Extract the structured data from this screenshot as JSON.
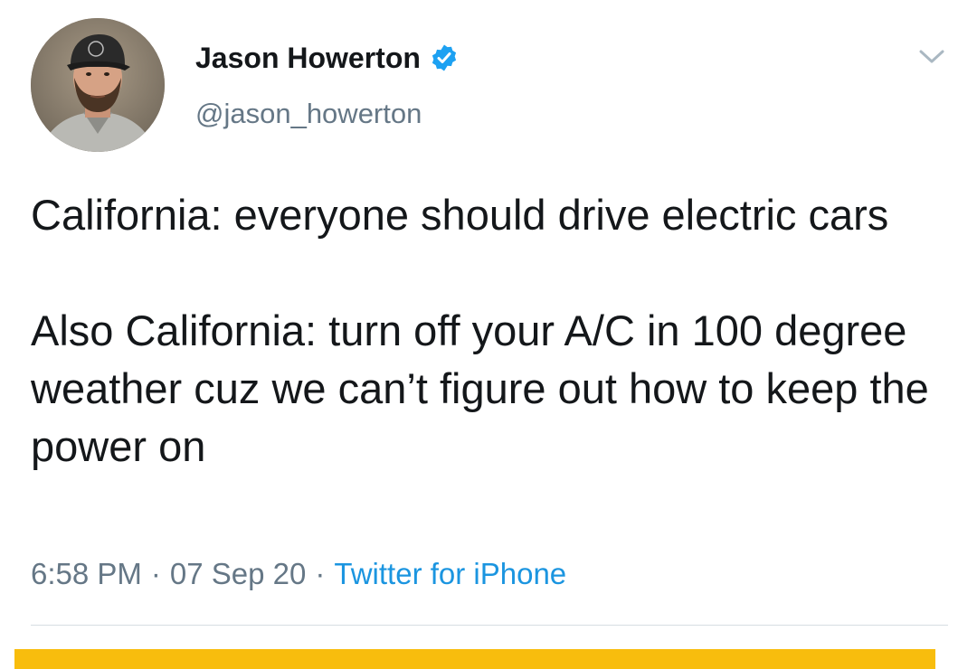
{
  "tweet": {
    "author": {
      "display_name": "Jason Howerton",
      "handle": "@jason_howerton",
      "verified": true,
      "avatar_icon": "profile-photo"
    },
    "menu_icon": "chevron-down-icon",
    "text": {
      "paragraph_1": "California: everyone should drive electric cars",
      "paragraph_2": "Also California: turn off your A/C in 100 degree weather cuz we can’t figure out how to keep the power on"
    },
    "meta": {
      "time": "6:58 PM",
      "date": "07 Sep 20",
      "separator": "·",
      "source": "Twitter for iPhone"
    }
  },
  "colors": {
    "text": "#14171a",
    "secondary_text": "#657786",
    "link": "#1b95e0",
    "verified_badge": "#1da1f2",
    "divider": "#d7dde2",
    "bottom_bar": "#f8bd0d"
  }
}
